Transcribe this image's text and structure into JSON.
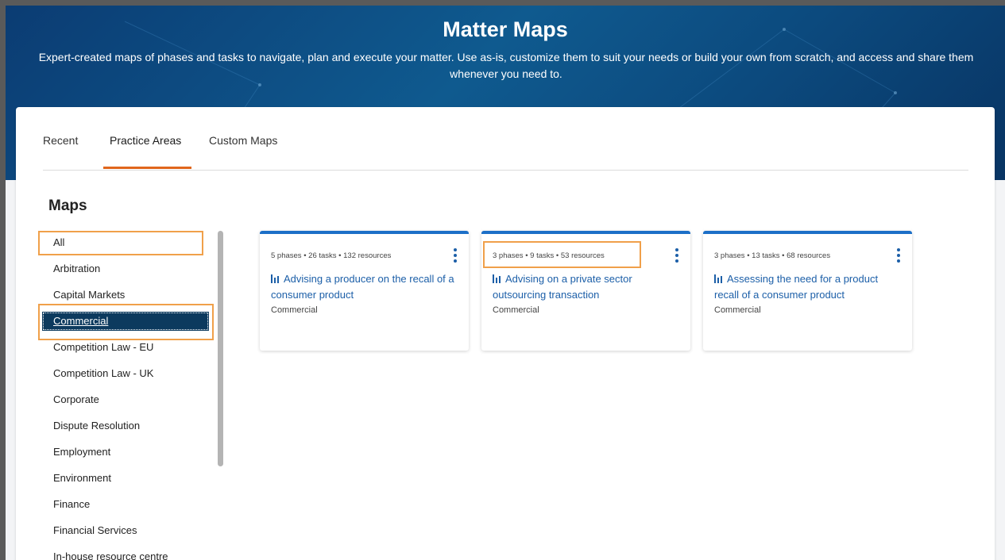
{
  "header": {
    "title": "Matter Maps",
    "subtitle": "Expert-created maps of phases and tasks to navigate, plan and execute your matter. Use as-is, customize them to suit your needs or build your own from scratch, and access and share them whenever you need to."
  },
  "tabs": [
    {
      "label": "Recent"
    },
    {
      "label": "Practice Areas",
      "active": true
    },
    {
      "label": "Custom Maps"
    }
  ],
  "sidebar": {
    "heading": "Maps",
    "selected": "Commercial",
    "items": [
      {
        "label": "All"
      },
      {
        "label": "Arbitration"
      },
      {
        "label": "Capital Markets"
      },
      {
        "label": "Commercial"
      },
      {
        "label": "Competition Law - EU"
      },
      {
        "label": "Competition Law - UK"
      },
      {
        "label": "Corporate"
      },
      {
        "label": "Dispute Resolution"
      },
      {
        "label": "Employment"
      },
      {
        "label": "Environment"
      },
      {
        "label": "Finance"
      },
      {
        "label": "Financial Services"
      },
      {
        "label": "In-house resource centre"
      }
    ]
  },
  "cards": [
    {
      "meta": "5 phases • 26 tasks • 132 resources",
      "title": "Advising a producer on the recall of a consumer product",
      "area": "Commercial"
    },
    {
      "meta": "3 phases • 9 tasks • 53 resources",
      "title": "Advising on a private sector outsourcing transaction",
      "area": "Commercial"
    },
    {
      "meta": "3 phases • 13 tasks • 68 resources",
      "title": "Assessing the need for a product recall of a consumer product",
      "area": "Commercial"
    }
  ],
  "icons": {
    "card_map": "map-icon",
    "card_menu": "kebab-menu-icon"
  },
  "colors": {
    "accent_tab": "#e0661c",
    "selected_item": "#0c3a5e",
    "card_border": "#1c6fc7",
    "link": "#1c5fa8",
    "highlight": "#f0a04a"
  }
}
